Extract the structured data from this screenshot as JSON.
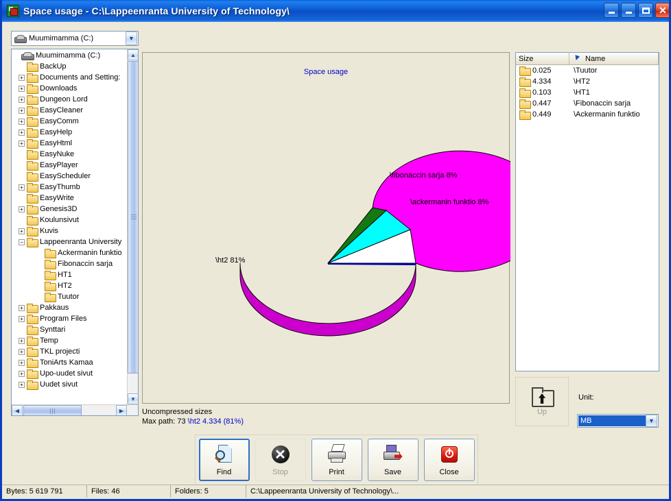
{
  "window": {
    "title": "Space usage - C:\\Lappeenranta University of Technology\\",
    "icon": "app-icon",
    "buttons": {
      "minimize": "minimize-icon",
      "minimize2": "minimize-icon",
      "maximize": "maximize-icon",
      "close": "close-icon"
    }
  },
  "drive_combo": {
    "value": "Muumimamma (C:)",
    "arrow": "chevron-down-icon"
  },
  "tree": {
    "root": {
      "label": "Muumimamma (C:)",
      "icon": "drive-icon"
    },
    "items": [
      {
        "label": "BackUp",
        "toggle": "",
        "depth": 1
      },
      {
        "label": "Documents and Setting:",
        "toggle": "+",
        "depth": 1
      },
      {
        "label": "Downloads",
        "toggle": "+",
        "depth": 1
      },
      {
        "label": "Dungeon Lord",
        "toggle": "+",
        "depth": 1
      },
      {
        "label": "EasyCleaner",
        "toggle": "+",
        "depth": 1
      },
      {
        "label": "EasyComm",
        "toggle": "+",
        "depth": 1
      },
      {
        "label": "EasyHelp",
        "toggle": "+",
        "depth": 1
      },
      {
        "label": "EasyHtml",
        "toggle": "+",
        "depth": 1
      },
      {
        "label": "EasyNuke",
        "toggle": "",
        "depth": 1
      },
      {
        "label": "EasyPlayer",
        "toggle": "",
        "depth": 1
      },
      {
        "label": "EasyScheduler",
        "toggle": "",
        "depth": 1
      },
      {
        "label": "EasyThumb",
        "toggle": "+",
        "depth": 1
      },
      {
        "label": "EasyWrite",
        "toggle": "",
        "depth": 1
      },
      {
        "label": "Genesis3D",
        "toggle": "+",
        "depth": 1
      },
      {
        "label": "Koulunsivut",
        "toggle": "",
        "depth": 1
      },
      {
        "label": "Kuvis",
        "toggle": "+",
        "depth": 1
      },
      {
        "label": "Lappeenranta University",
        "toggle": "−",
        "depth": 1
      },
      {
        "label": "Ackermanin funktio",
        "toggle": "",
        "depth": 2
      },
      {
        "label": "Fibonaccin sarja",
        "toggle": "",
        "depth": 2
      },
      {
        "label": "HT1",
        "toggle": "",
        "depth": 2
      },
      {
        "label": "HT2",
        "toggle": "",
        "depth": 2
      },
      {
        "label": "Tuutor",
        "toggle": "",
        "depth": 2
      },
      {
        "label": "Pakkaus",
        "toggle": "+",
        "depth": 1
      },
      {
        "label": "Program Files",
        "toggle": "+",
        "depth": 1
      },
      {
        "label": "Synttari",
        "toggle": "",
        "depth": 1
      },
      {
        "label": "Temp",
        "toggle": "+",
        "depth": 1
      },
      {
        "label": "TKL projecti",
        "toggle": "+",
        "depth": 1
      },
      {
        "label": "ToniArts Kamaa",
        "toggle": "+",
        "depth": 1
      },
      {
        "label": "Upo-uudet sivut",
        "toggle": "+",
        "depth": 1
      },
      {
        "label": "Uudet sivut",
        "toggle": "+",
        "depth": 1
      }
    ]
  },
  "list": {
    "columns": {
      "size": "Size",
      "name": "Name",
      "sort_icon": "sort-arrow-icon"
    },
    "rows": [
      {
        "size": "0.025",
        "name": "\\Tuutor"
      },
      {
        "size": "4.334",
        "name": "\\HT2"
      },
      {
        "size": "0.103",
        "name": "\\HT1"
      },
      {
        "size": "0.447",
        "name": "\\Fibonaccin sarja"
      },
      {
        "size": "0.449",
        "name": "\\Ackermanin funktio"
      }
    ]
  },
  "chart_info": {
    "line1": "Uncompressed sizes",
    "line2_prefix": "Max path: 73",
    "line2_highlight": "\\ht2 4.334 (81%)"
  },
  "up_button": {
    "label": "Up",
    "icon": "folder-up-icon"
  },
  "unit": {
    "label": "Unit:",
    "value": "MB",
    "arrow": "chevron-down-icon"
  },
  "toolbar": {
    "find": {
      "label": "Find",
      "icon": "find-icon"
    },
    "stop": {
      "label": "Stop",
      "icon": "stop-icon"
    },
    "print": {
      "label": "Print",
      "icon": "print-icon"
    },
    "save": {
      "label": "Save",
      "icon": "save-icon"
    },
    "close": {
      "label": "Close",
      "icon": "power-close-icon"
    }
  },
  "statusbar": {
    "bytes": "Bytes: 5 619 791",
    "files": "Files: 46",
    "folders": "Folders: 5",
    "path": "C:\\Lappeenranta University of Technology\\..."
  },
  "chart_data": {
    "type": "pie",
    "title": "Space usage",
    "labels": [
      "\\ht2 81%",
      "\\fibonaccin sarja 8%",
      "\\ackermanin funktio 8%"
    ],
    "categories": [
      "\\ht2",
      "\\fibonaccin sarja",
      "\\ackermanin funktio",
      "\\ht1",
      "\\tuutor"
    ],
    "values": [
      81,
      8,
      8,
      2,
      0.5
    ],
    "raw_sizes_mb": [
      4.334,
      0.447,
      0.449,
      0.103,
      0.025
    ],
    "colors": [
      "#ff00ff",
      "#00ffff",
      "#ffffff",
      "#137a13",
      "#0000aa"
    ],
    "annotations": {
      "ht2": "\\ht2 81%",
      "fibonaccin": "\\fibonaccin sarja 8%",
      "ackermanin": "\\ackermanin funktio 8%"
    },
    "legend": "none",
    "grid": false,
    "unit": "MB"
  }
}
